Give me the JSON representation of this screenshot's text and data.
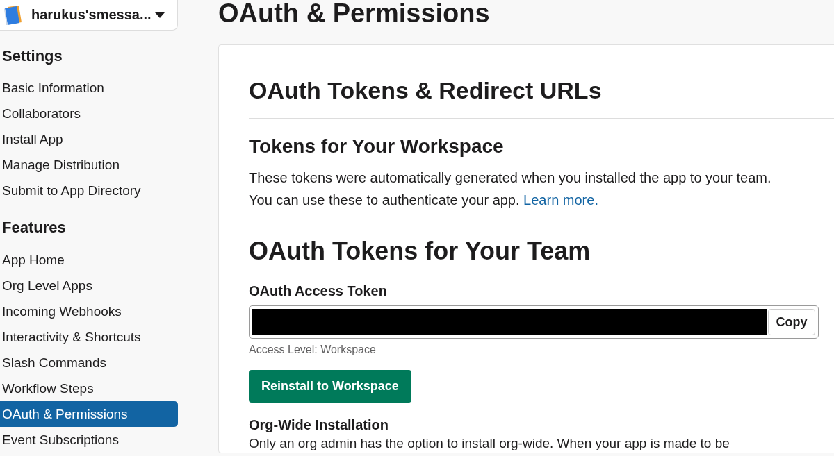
{
  "workspace": {
    "name": "harukus'smessa..."
  },
  "sidebar": {
    "sections": [
      {
        "title": "Settings",
        "items": [
          {
            "label": "Basic Information",
            "selected": false
          },
          {
            "label": "Collaborators",
            "selected": false
          },
          {
            "label": "Install App",
            "selected": false
          },
          {
            "label": "Manage Distribution",
            "selected": false
          },
          {
            "label": "Submit to App Directory",
            "selected": false
          }
        ]
      },
      {
        "title": "Features",
        "items": [
          {
            "label": "App Home",
            "selected": false
          },
          {
            "label": "Org Level Apps",
            "selected": false
          },
          {
            "label": "Incoming Webhooks",
            "selected": false
          },
          {
            "label": "Interactivity & Shortcuts",
            "selected": false
          },
          {
            "label": "Slash Commands",
            "selected": false
          },
          {
            "label": "Workflow Steps",
            "selected": false
          },
          {
            "label": "OAuth & Permissions",
            "selected": true
          },
          {
            "label": "Event Subscriptions",
            "selected": false
          }
        ]
      }
    ]
  },
  "page": {
    "title": "OAuth & Permissions"
  },
  "card": {
    "title": "OAuth Tokens & Redirect URLs",
    "subtitle": "Tokens for Your Workspace",
    "description": "These tokens were automatically generated when you installed the app to your team. You can use these to authenticate your app.",
    "learn_more_link": "Learn more.",
    "team_heading": "OAuth Tokens for Your Team",
    "token": {
      "label": "OAuth Access Token",
      "redacted": true,
      "copy_button": "Copy",
      "note": "Access Level: Workspace"
    },
    "reinstall_button": "Reinstall to Workspace",
    "org_wide": {
      "title": "Org-Wide Installation",
      "text": "Only an org admin has the option to install org-wide. When your app is made to be"
    }
  }
}
